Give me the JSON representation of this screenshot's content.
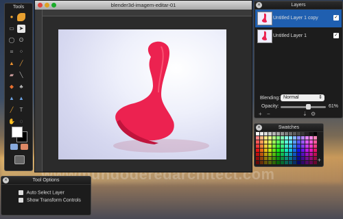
{
  "tools_panel": {
    "title": "Tools"
  },
  "document": {
    "title": "blender3d-imagem-editar-01"
  },
  "layers_panel": {
    "title": "Layers",
    "layers": [
      {
        "name": "Untitled Layer 1 copy",
        "visible": true,
        "selected": true
      },
      {
        "name": "Untitled Layer 1",
        "visible": true,
        "selected": false
      }
    ],
    "blending_label": "Blending:",
    "blending_value": "Normal",
    "opacity_label": "Opacity:",
    "opacity_value": "61%",
    "opacity_fraction": 0.61,
    "footer_add": "+",
    "footer_remove": "−",
    "footer_merge": "⇣",
    "footer_settings": "⚙"
  },
  "swatches_panel": {
    "title": "Swatches",
    "add": "+"
  },
  "tool_options_panel": {
    "title": "Tool Options",
    "options": [
      {
        "label": "Auto Select Layer",
        "checked": false
      },
      {
        "label": "Show Transform Controls",
        "checked": false
      }
    ]
  },
  "colors": {
    "chair": "#ec2250",
    "selection_blue": "#1f5fb0",
    "panel_bg": "#1c1c1c"
  },
  "watermark": "wwwmundoderedarchitect.com"
}
